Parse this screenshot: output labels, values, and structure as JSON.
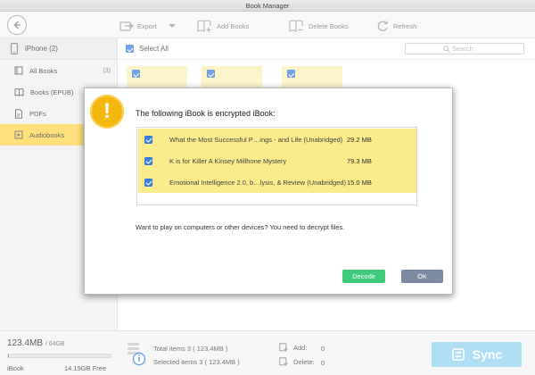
{
  "window": {
    "title": "Book Manager"
  },
  "toolbar": {
    "export_label": "Export",
    "add_books_label": "Add Books",
    "delete_books_label": "Delete Books",
    "refresh_label": "Refresh"
  },
  "sidebar": {
    "device": "iPhone (2)",
    "items": [
      {
        "label": "All Books",
        "count": "(3)",
        "icon": "book-icon"
      },
      {
        "label": "Books (EPUB)",
        "count": "",
        "icon": "open-book-icon"
      },
      {
        "label": "PDFs",
        "count": "",
        "icon": "pdf-icon"
      },
      {
        "label": "Audiobooks",
        "count": "",
        "icon": "audiobook-icon",
        "active": true
      }
    ]
  },
  "content": {
    "select_all_label": "Select All",
    "search_placeholder": "Search"
  },
  "dialog": {
    "title": "The following iBook is encrypted iBook:",
    "items": [
      {
        "name": "What the Most Successful P…ings - and Life (Unabridged)",
        "size": "29.2 MB",
        "checked": true
      },
      {
        "name": "K is for Killer A Kinsey Millhone Mystery",
        "size": "79.3 MB",
        "checked": true
      },
      {
        "name": "Emotional Intelligence 2.0, b…lysis, & Review (Unabridged)",
        "size": "15.0 MB",
        "checked": true
      }
    ],
    "prompt": "Want to play on computers or other devices? You need to decrypt files.",
    "decode_label": "Decode",
    "ok_label": "OK"
  },
  "footer": {
    "used": "123.4MB",
    "capacity": "/ 64GB",
    "usage_fraction": 0.002,
    "category": "iBook",
    "free": "14.19GB Free",
    "total_items": "Total items 3 ( 123.4MB )",
    "selected_items": "Selected items 3 ( 123.4MB )",
    "add_label": "Add:",
    "add_count": "0",
    "delete_label": "Delete:",
    "delete_count": "0",
    "sync_label": "Sync"
  },
  "colors": {
    "accent": "#ffd54a",
    "sync": "#8fd3f2",
    "decode": "#3fcc7a",
    "ok": "#7c8aa4",
    "warning": "#f5b80d"
  }
}
